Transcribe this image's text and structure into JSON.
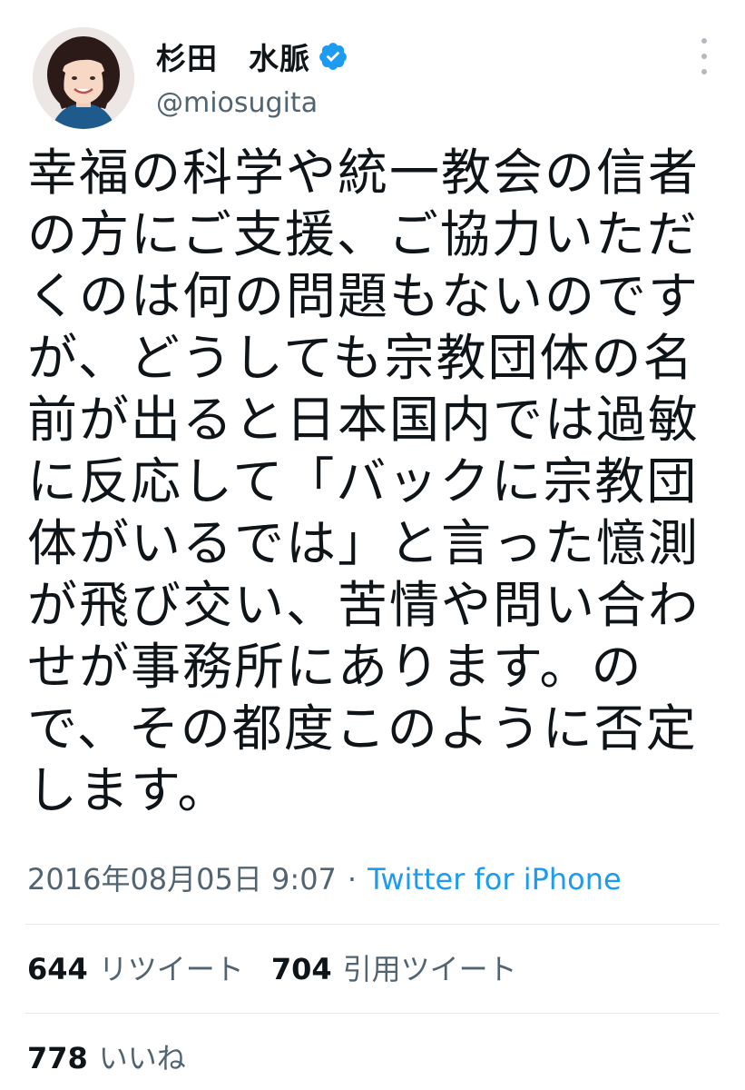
{
  "header": {
    "display_name": "杉田　水脈",
    "handle": "@miosugita",
    "avatar": "profile-photo",
    "verified_icon": "verified-badge-icon",
    "more_icon": "more-vertical-icon"
  },
  "tweet": {
    "lines": [
      "幸福の科学や統一教会の信者",
      "の方にご支援、ご協力いただ",
      "くのは何の問題もないのです",
      "が、どうしても宗教団体の名",
      "前が出ると日本国内では過敏",
      "に反応して「バックに宗教団",
      "体がいるでは」と言った憶測",
      "が飛び交い、苦情や問い合わ",
      "せが事務所にあります。の",
      "で、その都度このように否定",
      "します。"
    ]
  },
  "meta": {
    "timestamp": "2016年08月05日 9:07",
    "separator": "·",
    "source": "Twitter for iPhone"
  },
  "stats": {
    "retweets_count": "644",
    "retweets_label": "リツイート",
    "quotes_count": "704",
    "quotes_label": "引用ツイート",
    "likes_count": "778",
    "likes_label": "いいね"
  },
  "colors": {
    "text": "#0f1419",
    "secondary": "#536471",
    "link": "#1d9bf0",
    "verified": "#1d9bf0",
    "divider": "#e6e9eb"
  }
}
